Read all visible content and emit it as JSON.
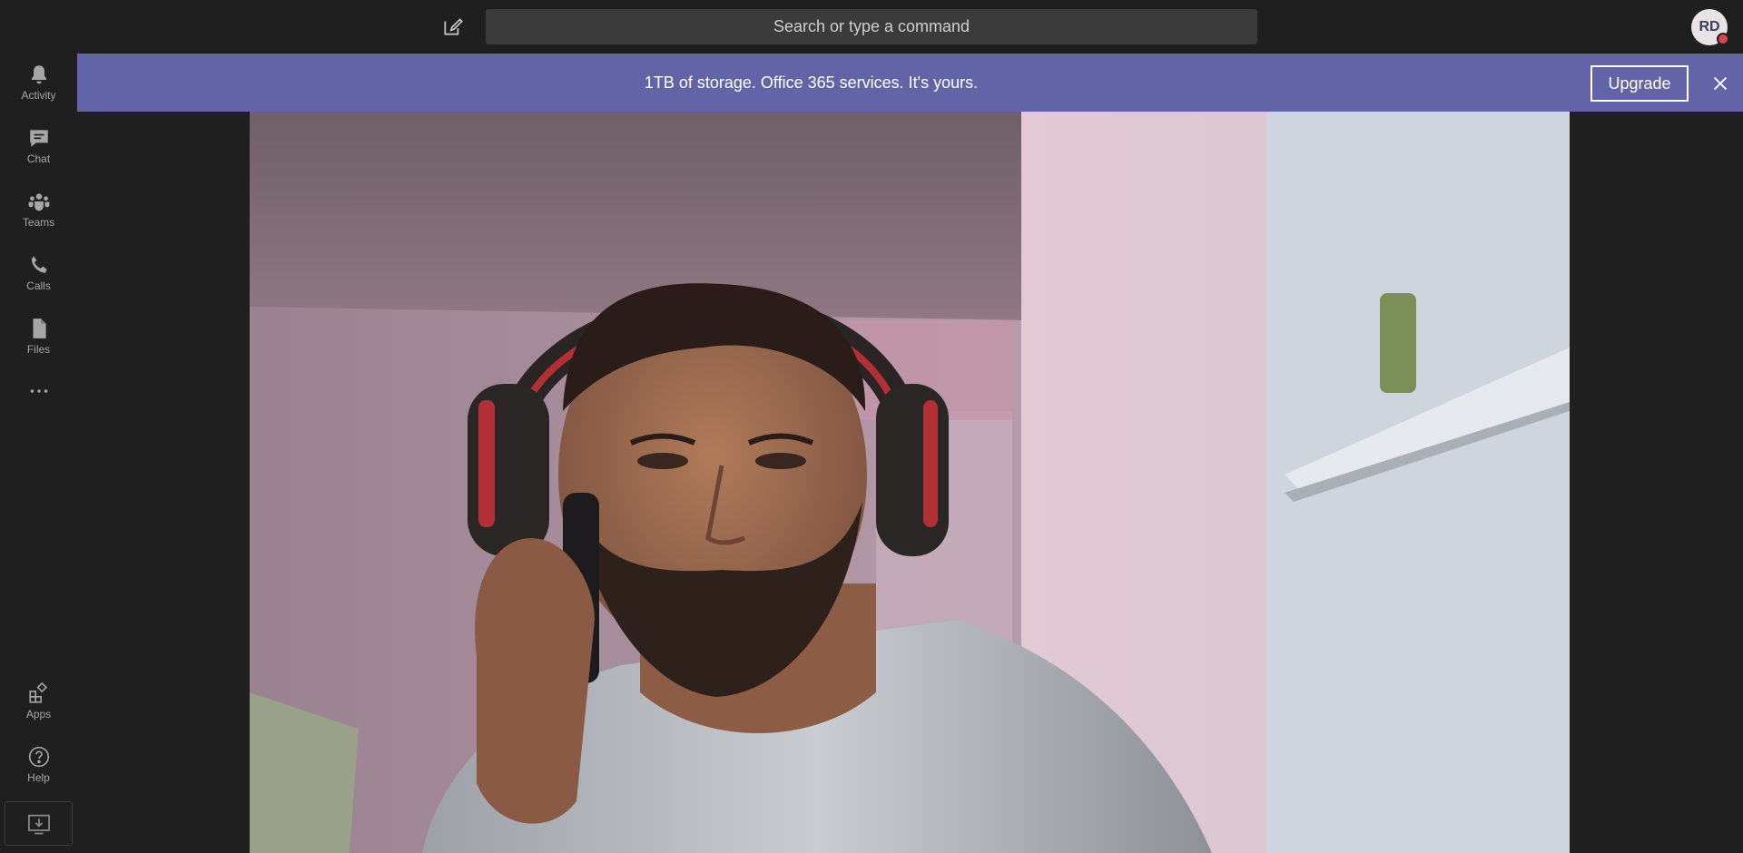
{
  "topbar": {
    "compose_icon": "compose-icon",
    "search_placeholder": "Search or type a command",
    "avatar_initials": "RD",
    "presence_color": "#d74654"
  },
  "rail": {
    "items": [
      {
        "label": "Activity",
        "icon": "bell-icon"
      },
      {
        "label": "Chat",
        "icon": "chat-icon"
      },
      {
        "label": "Teams",
        "icon": "teams-icon"
      },
      {
        "label": "Calls",
        "icon": "phone-icon"
      },
      {
        "label": "Files",
        "icon": "file-icon"
      },
      {
        "label": "",
        "icon": "more-icon"
      },
      {
        "label": "Apps",
        "icon": "apps-icon"
      },
      {
        "label": "Help",
        "icon": "help-icon"
      }
    ],
    "download_icon": "download-icon"
  },
  "banner": {
    "text": "1TB of storage. Office 365 services. It's yours.",
    "upgrade_label": "Upgrade",
    "close_icon": "close-icon",
    "color": "#6264a7"
  },
  "video": {
    "description_icon": "camera-feed"
  }
}
